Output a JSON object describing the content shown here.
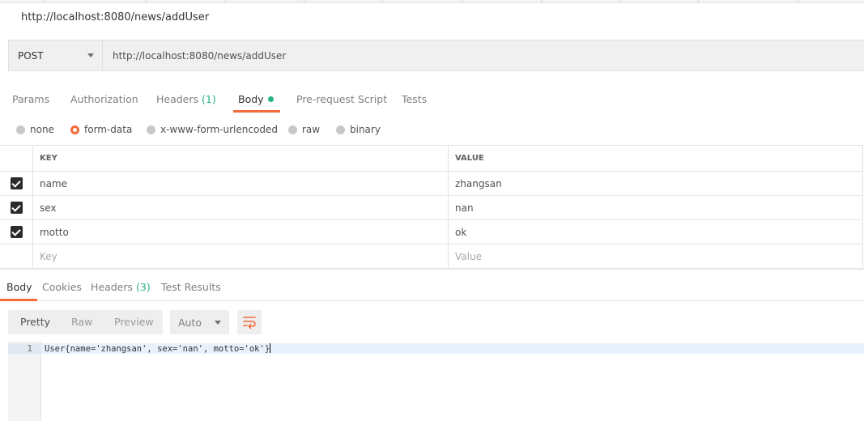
{
  "request": {
    "title": "http://localhost:8080/news/addUser",
    "method": "POST",
    "url": "http://localhost:8080/news/addUser"
  },
  "request_tabs": [
    {
      "label": "Params"
    },
    {
      "label": "Authorization"
    },
    {
      "label": "Headers",
      "count": "(1)"
    },
    {
      "label": "Body"
    },
    {
      "label": "Pre-request Script"
    },
    {
      "label": "Tests"
    }
  ],
  "body_types": [
    {
      "label": "none"
    },
    {
      "label": "form-data"
    },
    {
      "label": "x-www-form-urlencoded"
    },
    {
      "label": "raw"
    },
    {
      "label": "binary"
    }
  ],
  "body_table": {
    "headers": {
      "key": "KEY",
      "value": "VALUE"
    },
    "rows": [
      {
        "key": "name",
        "value": "zhangsan"
      },
      {
        "key": "sex",
        "value": "nan"
      },
      {
        "key": "motto",
        "value": "ok"
      }
    ],
    "placeholder": {
      "key": "Key",
      "value": "Value"
    }
  },
  "response_tabs": [
    {
      "label": "Body"
    },
    {
      "label": "Cookies"
    },
    {
      "label": "Headers",
      "count": "(3)"
    },
    {
      "label": "Test Results"
    }
  ],
  "view_modes": [
    {
      "label": "Pretty"
    },
    {
      "label": "Raw"
    },
    {
      "label": "Preview"
    }
  ],
  "format_select": {
    "value": "Auto"
  },
  "response": {
    "line_number": "1",
    "text": "User{name='zhangsan', sex='nan', motto='ok'}"
  },
  "colors": {
    "accent": "#f26b3a",
    "green": "#26b47f"
  },
  "icons": {
    "method_dropdown": "chevron-down-icon",
    "format_dropdown": "chevron-down-icon",
    "wrap": "wrap-lines-icon",
    "checkbox": "check-icon"
  }
}
